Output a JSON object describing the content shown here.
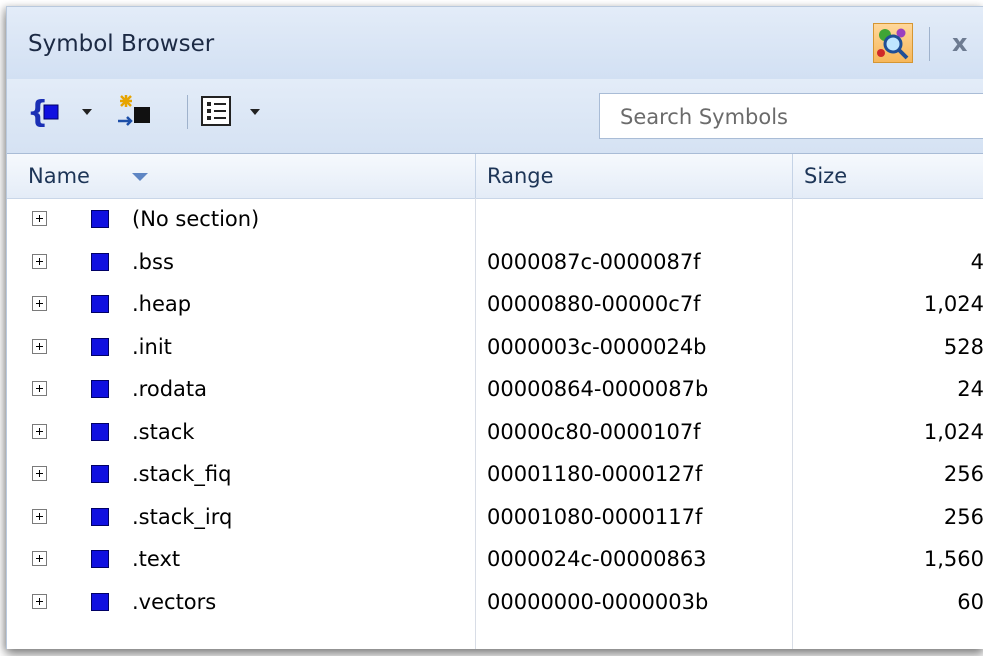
{
  "panel": {
    "title": "Symbol Browser",
    "find_icon": "find-symbols-icon",
    "close_label": "x"
  },
  "toolbar": {
    "buttons": [
      {
        "icon": "struct-icon",
        "dropdown": true
      },
      {
        "icon": "new-item-sparkle-icon",
        "dropdown": false
      },
      {
        "icon": "list-view-icon",
        "dropdown": true
      }
    ]
  },
  "search": {
    "placeholder": "Search Symbols"
  },
  "columns": {
    "name": "Name",
    "range": "Range",
    "size": "Size",
    "sort": "descending"
  },
  "colors": {
    "section_icon": "#1010e0",
    "header_text": "#1d3557",
    "titlebar": "#dce7f6"
  },
  "rows": [
    {
      "name": "(No section)",
      "range": "",
      "size": ""
    },
    {
      "name": ".bss",
      "range": "0000087c-0000087f",
      "size": "4"
    },
    {
      "name": ".heap",
      "range": "00000880-00000c7f",
      "size": "1,024"
    },
    {
      "name": ".init",
      "range": "0000003c-0000024b",
      "size": "528"
    },
    {
      "name": ".rodata",
      "range": "00000864-0000087b",
      "size": "24"
    },
    {
      "name": ".stack",
      "range": "00000c80-0000107f",
      "size": "1,024"
    },
    {
      "name": ".stack_fiq",
      "range": "00001180-0000127f",
      "size": "256"
    },
    {
      "name": ".stack_irq",
      "range": "00001080-0000117f",
      "size": "256"
    },
    {
      "name": ".text",
      "range": "0000024c-00000863",
      "size": "1,560"
    },
    {
      "name": ".vectors",
      "range": "00000000-0000003b",
      "size": "60"
    }
  ]
}
